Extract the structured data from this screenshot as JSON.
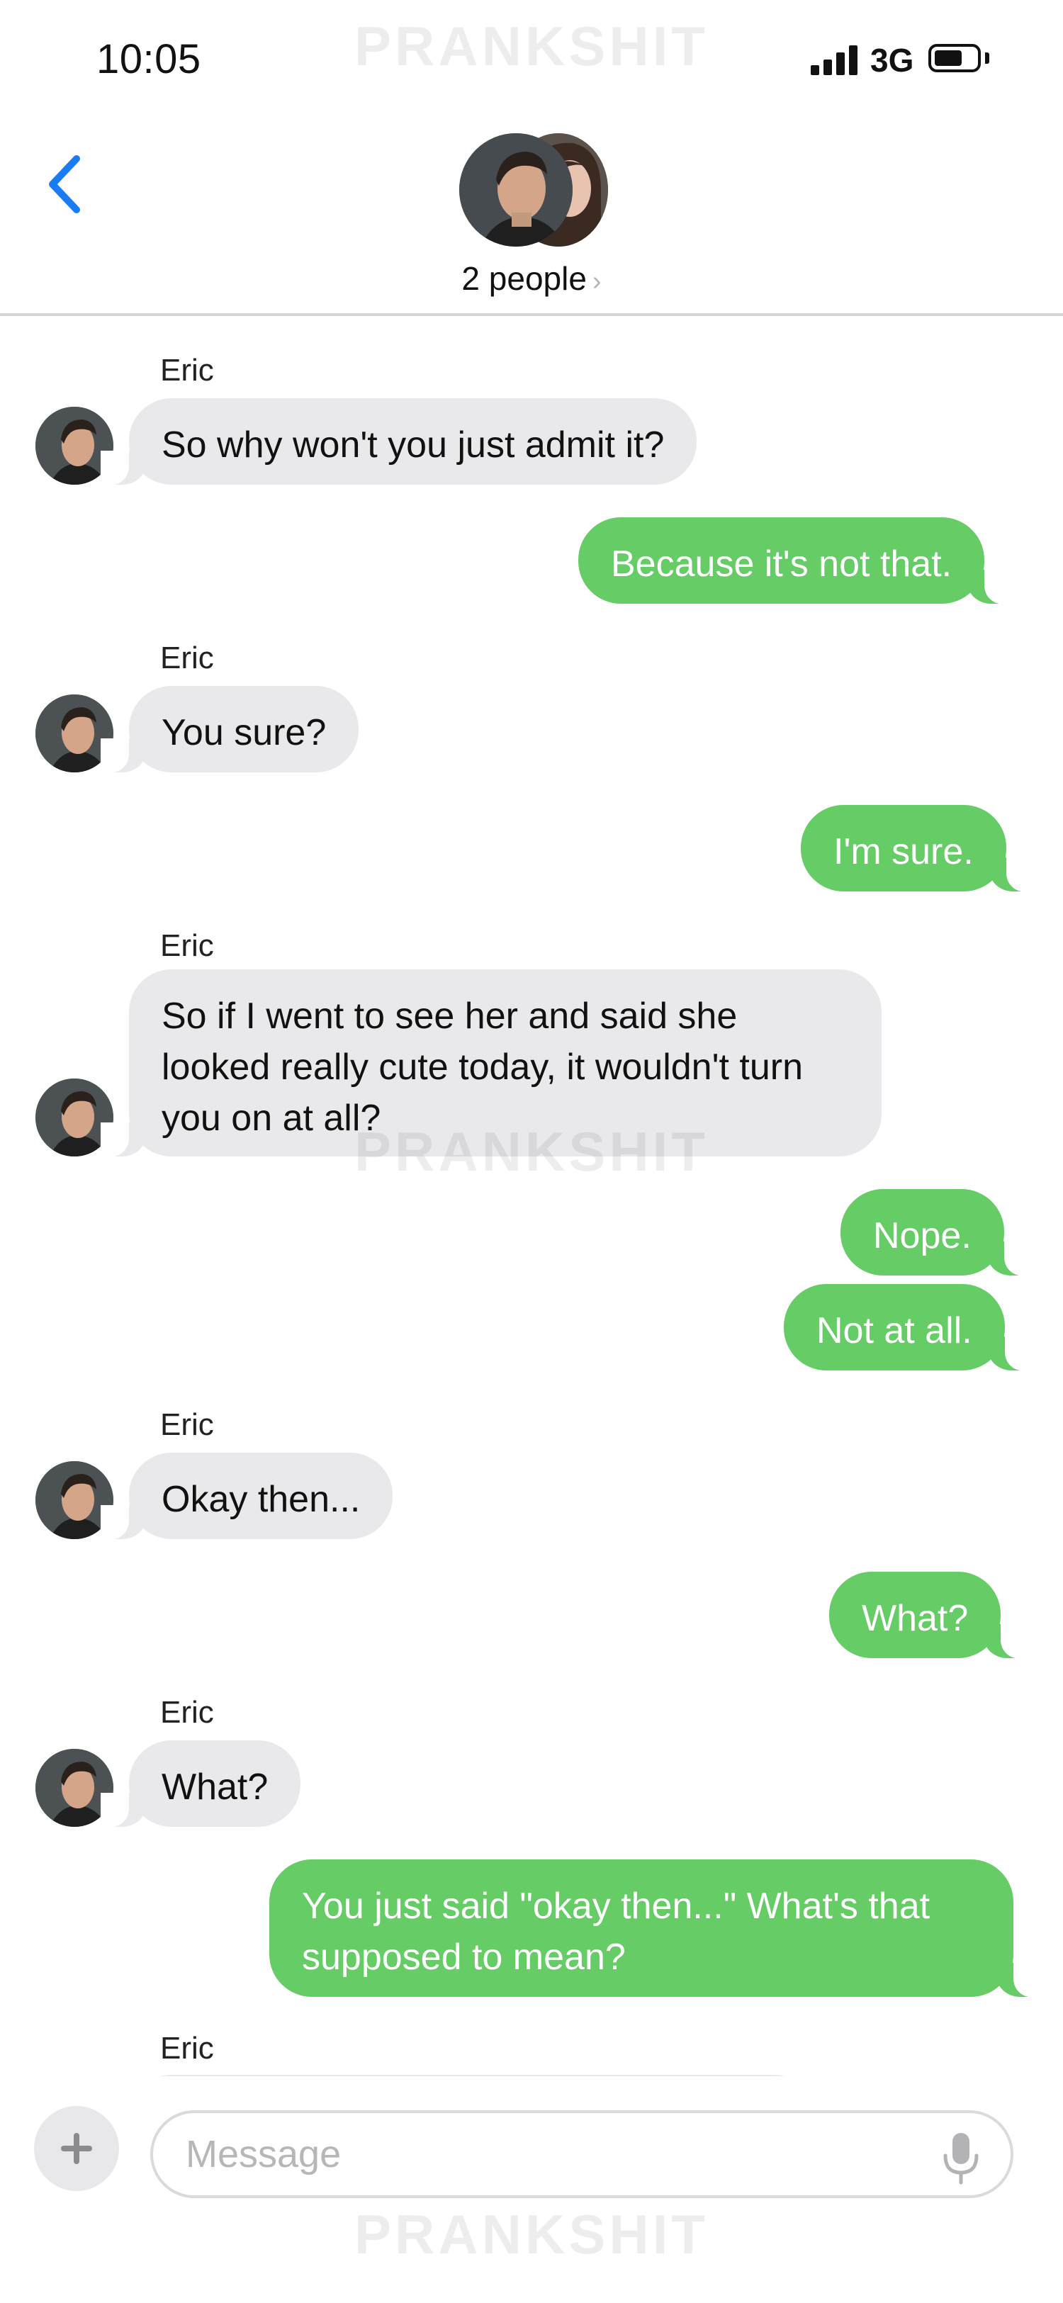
{
  "status_bar": {
    "time": "10:05",
    "network": "3G"
  },
  "header": {
    "title": "2 people",
    "chevron": "›"
  },
  "watermark": "PRANKSHIT",
  "icons": {
    "back": "chevron-left-icon",
    "plus": "plus-icon",
    "mic": "microphone-icon"
  },
  "colors": {
    "accent": "#1a7cf5",
    "outgoing_bubble": "#66cc66",
    "incoming_bubble": "#e9e9eb"
  },
  "messages": [
    {
      "from": "Eric",
      "direction": "incoming",
      "text": "So why won't you just admit it?"
    },
    {
      "from": "me",
      "direction": "outgoing",
      "text": "Because it's not that."
    },
    {
      "from": "Eric",
      "direction": "incoming",
      "text": "You sure?"
    },
    {
      "from": "me",
      "direction": "outgoing",
      "text": "I'm sure."
    },
    {
      "from": "Eric",
      "direction": "incoming",
      "lines": [
        "So if I went to see her and said she",
        "looked really cute today, it wouldn't turn",
        "you on at all?"
      ]
    },
    {
      "from": "me",
      "direction": "outgoing",
      "text": "Nope."
    },
    {
      "from": "me",
      "direction": "outgoing",
      "text": "Not at all."
    },
    {
      "from": "Eric",
      "direction": "incoming",
      "text": "Okay then..."
    },
    {
      "from": "me",
      "direction": "outgoing",
      "text": "What?"
    },
    {
      "from": "Eric",
      "direction": "incoming",
      "text": "What?"
    },
    {
      "from": "me",
      "direction": "outgoing",
      "lines": [
        "You just said \"okay then...\" What's that",
        "supposed to mean?"
      ]
    }
  ],
  "pending_sender": "Eric",
  "composer": {
    "placeholder": "Message"
  }
}
